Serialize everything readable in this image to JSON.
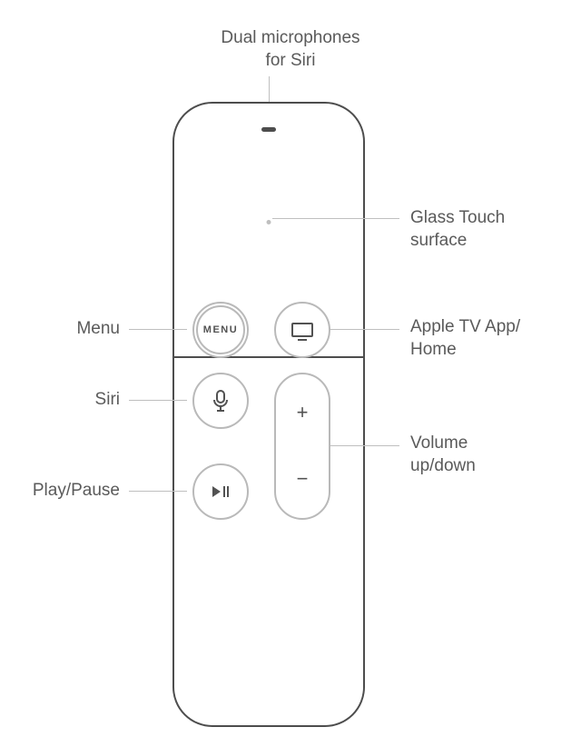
{
  "labels": {
    "mic_l1": "Dual microphones",
    "mic_l2": "for Siri",
    "touch_l1": "Glass Touch",
    "touch_l2": "surface",
    "menu": "Menu",
    "tv_l1": "Apple TV App/",
    "tv_l2": "Home",
    "siri": "Siri",
    "vol_l1": "Volume",
    "vol_l2": "up/down",
    "play": "Play/Pause"
  },
  "buttons": {
    "menu_text": "MENU",
    "vol_plus": "+",
    "vol_minus": "−"
  }
}
